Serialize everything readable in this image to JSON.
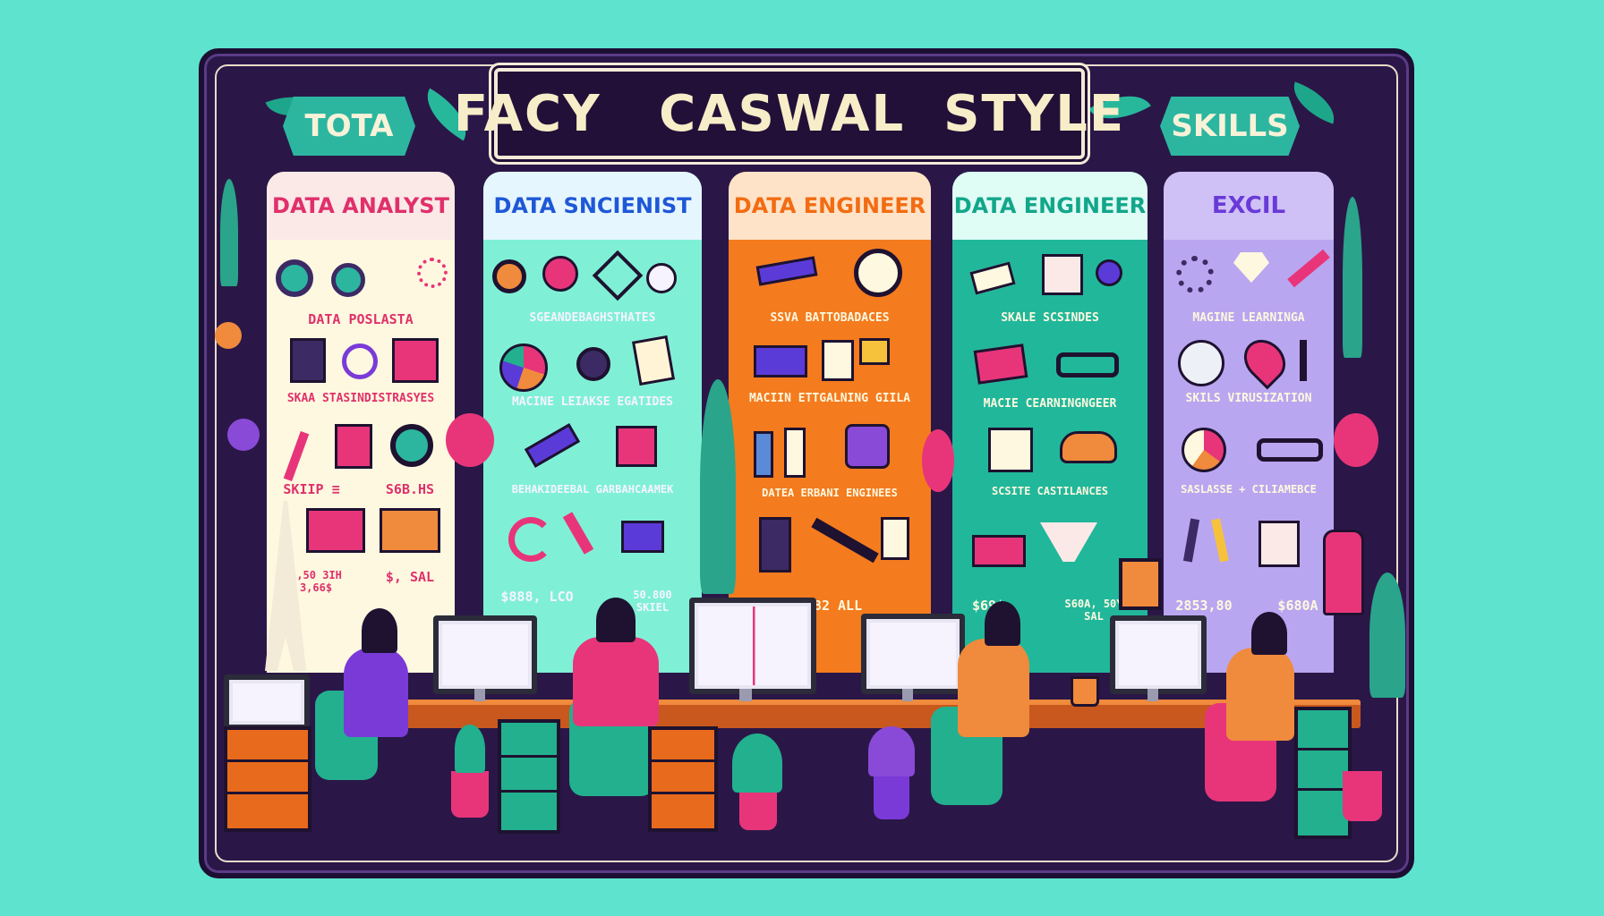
{
  "header": {
    "title": "FACY   CASWAL  STYLE",
    "left_ribbon": "TOTA",
    "right_ribbon": "SKILLS"
  },
  "columns": [
    {
      "title": "DATA ANALYST",
      "head_bg": "#fbe9e7",
      "head_color": "#e0306c",
      "body_bg": "#fdf8df",
      "captions": [
        "DATA POSLASTA",
        "SKAA STASINDISTRASYES",
        "SKIIP ≡",
        "S6B.HS",
        "$,50 3IH\n3,66$",
        "$, SAL"
      ]
    },
    {
      "title": "DATA SNCIENIST",
      "head_bg": "#e6f6ff",
      "head_color": "#1e58d8",
      "body_bg": "#7ff0d6",
      "captions": [
        "SGEANDEBAGHSTHATES",
        "MACINE LEIAKSE EGATIDES",
        "BEHAKIDEEBAL GARBAHCAAMEK",
        "$888, LCO",
        "50.800\nSKIEL"
      ]
    },
    {
      "title": "DATA ENGINEER",
      "head_bg": "#ffe3c8",
      "head_color": "#f26c12",
      "body_bg": "#f47b1e",
      "captions": [
        "SSVA BATTOBADACES",
        "MACIIN ETTGALNING GIILA",
        "DATEA ERBANI ENGINEES",
        "$382 ALL"
      ]
    },
    {
      "title": "DATA ENGINEER",
      "head_bg": "#dffcf5",
      "head_color": "#12a68a",
      "body_bg": "#21b79b",
      "captions": [
        "SKALE SCSINDES",
        "MACIE CEARNINGNGEER",
        "SCSITE CASTILANCES",
        "$69$",
        "S60A, 50Y\nSAL"
      ]
    },
    {
      "title": "EXCIL",
      "head_bg": "#cfc1f6",
      "head_color": "#6a3ad8",
      "body_bg": "#b9a6f0",
      "captions": [
        "MAGINE LEARNINGA",
        "SKILS VIRUSIZATION",
        "SASLASSE + CILIAMEBCE",
        "2853,80",
        "$680A"
      ]
    }
  ],
  "scene": {
    "monitors": 5,
    "people": 4
  }
}
